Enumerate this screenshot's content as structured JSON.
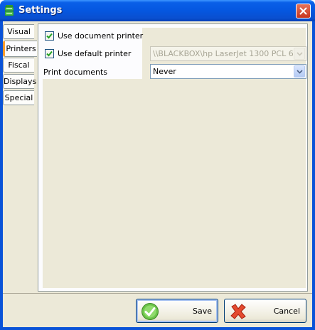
{
  "window": {
    "title": "Settings",
    "title_icon": "app-icon",
    "close_icon": "close-icon"
  },
  "tabs": [
    "Visual",
    "Printers",
    "Fiscal",
    "Displays",
    "Special"
  ],
  "active_tab": "Printers",
  "printers": {
    "use_document_printer": {
      "label": "Use document printer",
      "checked": true
    },
    "use_default_printer": {
      "label": "Use default printer",
      "checked": true
    },
    "printer_select": {
      "value": "\\\\BLACKBOX\\hp LaserJet 1300 PCL 6",
      "disabled": true
    },
    "print_documents": {
      "label": "Print documents",
      "value": "Never"
    }
  },
  "buttons": {
    "save": {
      "label": "Save",
      "icon": "check-icon",
      "color": "#5ab33c"
    },
    "cancel": {
      "label": "Cancel",
      "icon": "x-icon",
      "color": "#e0402a"
    }
  },
  "colors": {
    "titlebar": "#0557e0",
    "face": "#ece9d8",
    "active_tab_accent": "#ff9c2c"
  }
}
